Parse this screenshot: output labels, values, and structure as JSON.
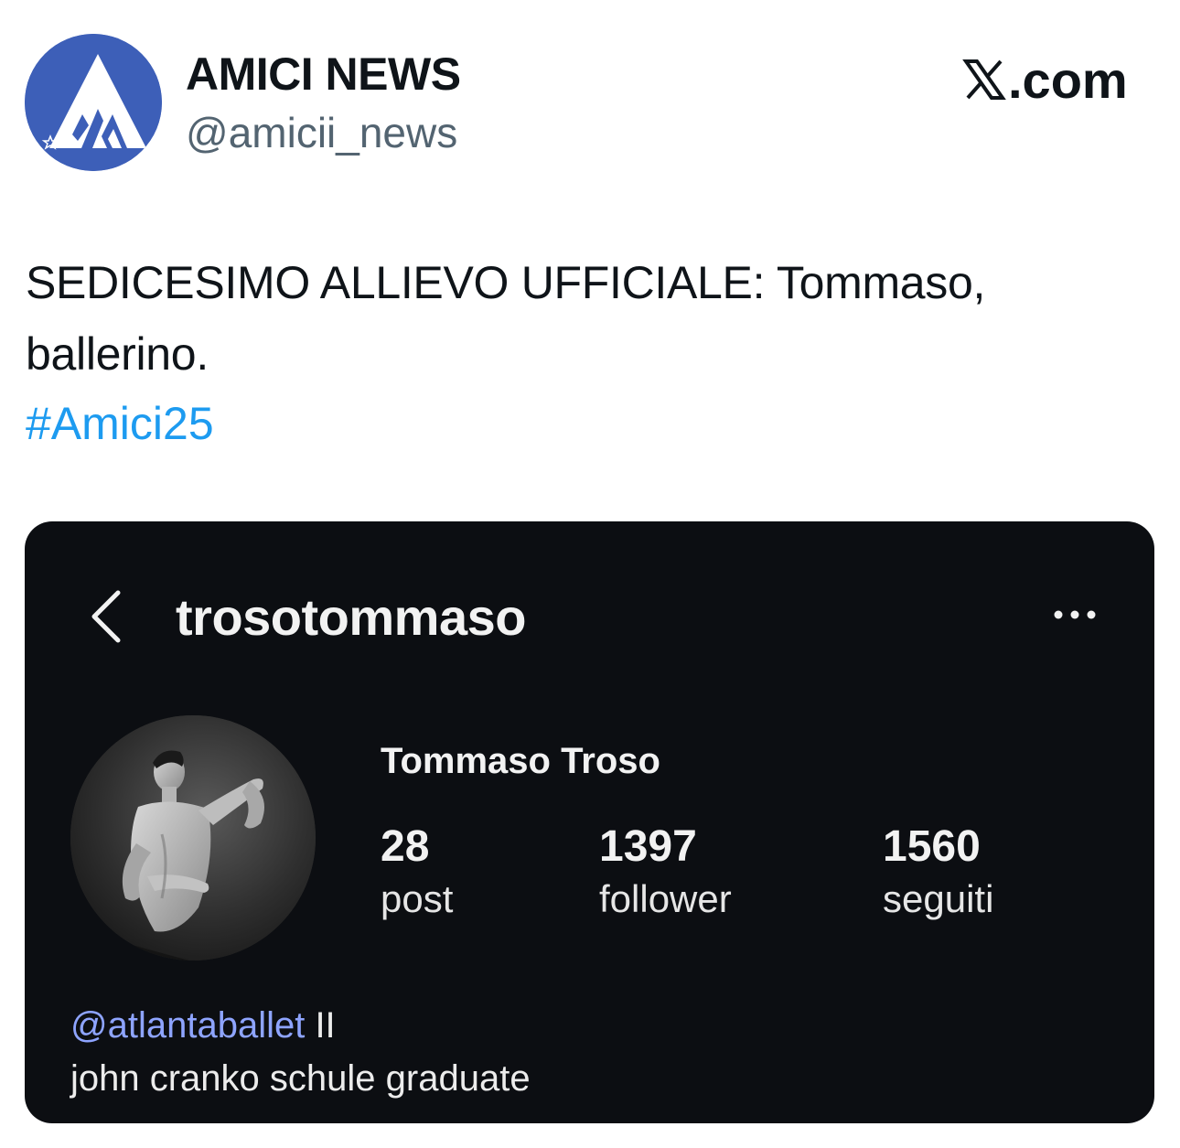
{
  "header": {
    "account_name": "AMICI NEWS",
    "account_handle": "@amicii_news",
    "brand": ".com",
    "brand_icon": "x-logo-icon",
    "avatar_icon": "amici-logo-icon",
    "avatar_color": "#3d5fb8"
  },
  "tweet": {
    "text": "SEDICESIMO ALLIEVO UFFICIALE: Tommaso, ballerino.",
    "hashtag": "#Amici25",
    "hashtag_color": "#1d9bf0"
  },
  "instagram_screenshot": {
    "username": "trosotommaso",
    "back_icon": "chevron-left-icon",
    "more_icon": "more-horizontal-icon",
    "full_name": "Tommaso Troso",
    "stats": {
      "posts": {
        "value": "28",
        "label": "post"
      },
      "followers": {
        "value": "1397",
        "label": "follower"
      },
      "following": {
        "value": "1560",
        "label": "seguiti"
      }
    },
    "bio_mention": "@atlantaballet",
    "bio_mention_suffix": " II",
    "bio_line2": "john cranko schule graduate",
    "background_color": "#0c0e12",
    "mention_color": "#8ea4ff"
  }
}
